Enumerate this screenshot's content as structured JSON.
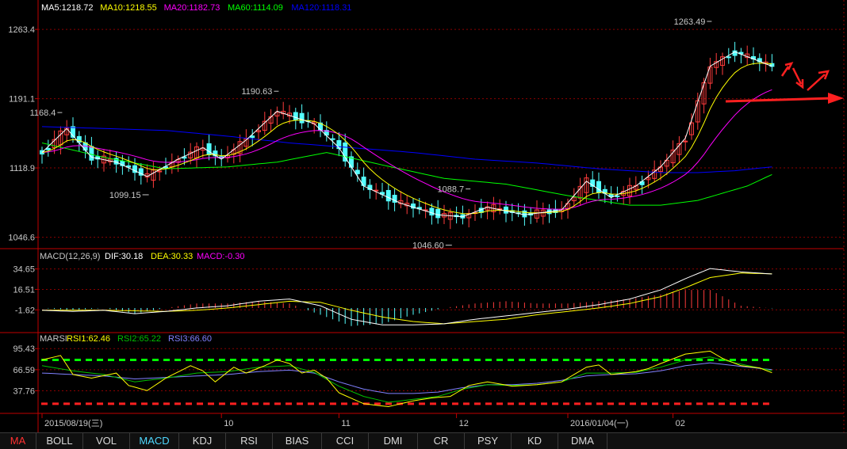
{
  "colors": {
    "up": "#ff3b3b",
    "down": "#54ffff",
    "ma5": "#ffffff",
    "ma10": "#ffff00",
    "ma20": "#ff00ff",
    "ma60": "#00ff00",
    "ma120": "#0000ff",
    "axis": "#c00000",
    "grid": "#8b0000",
    "text": "#c8c8c8",
    "annotation_arrow": "#ff2020"
  },
  "main_legend": [
    {
      "text": "MA5:1218.72",
      "color": "#ffffff"
    },
    {
      "text": "MA10:1218.55",
      "color": "#ffff00"
    },
    {
      "text": "MA20:1182.73",
      "color": "#ff00ff"
    },
    {
      "text": "MA60:1114.09",
      "color": "#00ff00"
    },
    {
      "text": "MA120:1118.31",
      "color": "#0000ff"
    }
  ],
  "macd_legend": [
    {
      "text": "MACD(12,26,9)",
      "color": "#c8c8c8"
    },
    {
      "text": "DIF:30.18",
      "color": "#ffffff"
    },
    {
      "text": "DEA:30.33",
      "color": "#ffff00"
    },
    {
      "text": "MACD:-0.30",
      "color": "#ff00ff"
    }
  ],
  "rsi_legend": [
    {
      "text": "MARSI",
      "color": "#c8c8c8"
    },
    {
      "text": "RSI1:62.46",
      "color": "#ffff00"
    },
    {
      "text": "RSI2:65.22",
      "color": "#00c000"
    },
    {
      "text": "RSI3:66.60",
      "color": "#8080ff"
    }
  ],
  "chart_data": [
    {
      "type": "candlestick",
      "panel": "price",
      "y_ticks": [
        "1263.4",
        "1191.1",
        "1118.9",
        "1046.6"
      ],
      "y_tick_values": [
        1263.4,
        1191.1,
        1118.9,
        1046.6
      ],
      "ylim": [
        1038,
        1280
      ],
      "x_tick_labels": [
        {
          "label": "2015/08/19(三)",
          "index": 0
        },
        {
          "label": "10",
          "index": 29
        },
        {
          "label": "11",
          "index": 48
        },
        {
          "label": "12",
          "index": 67
        },
        {
          "label": "2016/01/04(一)",
          "index": 85
        },
        {
          "label": "02",
          "index": 102
        }
      ],
      "annotations": [
        {
          "text": "1168.4",
          "index": 3,
          "value": 1168.4,
          "side": "high"
        },
        {
          "text": "1099.15",
          "index": 17,
          "value": 1099.15,
          "side": "low"
        },
        {
          "text": "1190.63",
          "index": 38,
          "value": 1190.63,
          "side": "high"
        },
        {
          "text": "1088.7",
          "index": 69,
          "value": 1088.7,
          "side": "high"
        },
        {
          "text": "1046.60",
          "index": 66,
          "value": 1046.6,
          "side": "low"
        },
        {
          "text": "1263.49",
          "index": 108,
          "value": 1263.49,
          "side": "high"
        }
      ],
      "series_style": {
        "ma5": "#ffffff",
        "ma10": "#ffff00",
        "ma20": "#ff00ff",
        "ma60": "#00ff00",
        "ma120": "#0000ff"
      },
      "ma60": [
        [
          0,
          1145
        ],
        [
          10,
          1130
        ],
        [
          20,
          1118
        ],
        [
          30,
          1120
        ],
        [
          38,
          1125
        ],
        [
          46,
          1135
        ],
        [
          55,
          1122
        ],
        [
          65,
          1108
        ],
        [
          75,
          1102
        ],
        [
          85,
          1090
        ],
        [
          95,
          1080
        ],
        [
          100,
          1080
        ],
        [
          106,
          1085
        ],
        [
          114,
          1100
        ],
        [
          118,
          1112
        ]
      ],
      "ma120": [
        [
          0,
          1162
        ],
        [
          10,
          1160
        ],
        [
          20,
          1158
        ],
        [
          30,
          1152
        ],
        [
          40,
          1145
        ],
        [
          50,
          1140
        ],
        [
          60,
          1135
        ],
        [
          70,
          1128
        ],
        [
          80,
          1124
        ],
        [
          90,
          1118
        ],
        [
          100,
          1114
        ],
        [
          106,
          1114
        ],
        [
          112,
          1116
        ],
        [
          118,
          1120
        ]
      ]
    },
    {
      "type": "bar+line",
      "panel": "macd",
      "title": "MACD(12,26,9)",
      "y_ticks": [
        "34.65",
        "16.51",
        "-1.62"
      ],
      "y_tick_values": [
        34.65,
        16.51,
        -1.62
      ],
      "ylim": [
        -19,
        40
      ],
      "dif": [
        [
          0,
          -2
        ],
        [
          5,
          -3
        ],
        [
          10,
          -2
        ],
        [
          15,
          -5
        ],
        [
          20,
          -3
        ],
        [
          25,
          0
        ],
        [
          30,
          2
        ],
        [
          35,
          6
        ],
        [
          40,
          8
        ],
        [
          45,
          2
        ],
        [
          50,
          -10
        ],
        [
          55,
          -15
        ],
        [
          60,
          -15
        ],
        [
          65,
          -14
        ],
        [
          70,
          -10
        ],
        [
          75,
          -7
        ],
        [
          80,
          -4
        ],
        [
          85,
          -1
        ],
        [
          90,
          3
        ],
        [
          95,
          8
        ],
        [
          100,
          16
        ],
        [
          104,
          26
        ],
        [
          108,
          35
        ],
        [
          113,
          32
        ],
        [
          118,
          30.18
        ]
      ],
      "dea": [
        [
          0,
          -2
        ],
        [
          10,
          -2
        ],
        [
          20,
          -3
        ],
        [
          25,
          -2
        ],
        [
          30,
          0
        ],
        [
          35,
          3
        ],
        [
          40,
          6
        ],
        [
          45,
          5
        ],
        [
          50,
          -2
        ],
        [
          55,
          -8
        ],
        [
          60,
          -12
        ],
        [
          65,
          -14
        ],
        [
          70,
          -12
        ],
        [
          75,
          -10
        ],
        [
          80,
          -6
        ],
        [
          85,
          -3
        ],
        [
          90,
          0
        ],
        [
          95,
          4
        ],
        [
          100,
          10
        ],
        [
          104,
          18
        ],
        [
          108,
          27
        ],
        [
          113,
          31
        ],
        [
          118,
          30.33
        ]
      ],
      "last_macd": -0.3
    },
    {
      "type": "line",
      "panel": "rsi",
      "title": "MARSI",
      "y_ticks": [
        "95.43",
        "66.59",
        "37.76"
      ],
      "y_tick_values": [
        95.43,
        66.59,
        37.76
      ],
      "ylim": [
        9,
        100
      ],
      "ref_lines": [
        {
          "value": 80,
          "color": "#00ff00"
        },
        {
          "value": 20,
          "color": "#ff2020"
        }
      ],
      "rsi1": [
        [
          0,
          80
        ],
        [
          3,
          86
        ],
        [
          5,
          60
        ],
        [
          8,
          55
        ],
        [
          12,
          62
        ],
        [
          14,
          45
        ],
        [
          17,
          38
        ],
        [
          20,
          55
        ],
        [
          24,
          72
        ],
        [
          26,
          65
        ],
        [
          28,
          50
        ],
        [
          31,
          70
        ],
        [
          33,
          62
        ],
        [
          36,
          72
        ],
        [
          38,
          80
        ],
        [
          40,
          75
        ],
        [
          42,
          62
        ],
        [
          44,
          66
        ],
        [
          46,
          55
        ],
        [
          48,
          35
        ],
        [
          52,
          20
        ],
        [
          56,
          16
        ],
        [
          60,
          24
        ],
        [
          63,
          28
        ],
        [
          66,
          30
        ],
        [
          69,
          45
        ],
        [
          72,
          50
        ],
        [
          76,
          44
        ],
        [
          80,
          46
        ],
        [
          84,
          50
        ],
        [
          88,
          70
        ],
        [
          90,
          73
        ],
        [
          92,
          60
        ],
        [
          96,
          64
        ],
        [
          98,
          68
        ],
        [
          100,
          75
        ],
        [
          104,
          88
        ],
        [
          108,
          92
        ],
        [
          110,
          82
        ],
        [
          113,
          72
        ],
        [
          116,
          69
        ],
        [
          118,
          62.46
        ]
      ],
      "rsi2": [
        [
          0,
          72
        ],
        [
          5,
          65
        ],
        [
          10,
          60
        ],
        [
          15,
          50
        ],
        [
          20,
          55
        ],
        [
          25,
          62
        ],
        [
          30,
          64
        ],
        [
          35,
          70
        ],
        [
          40,
          72
        ],
        [
          44,
          63
        ],
        [
          48,
          44
        ],
        [
          52,
          30
        ],
        [
          56,
          22
        ],
        [
          60,
          26
        ],
        [
          64,
          30
        ],
        [
          68,
          40
        ],
        [
          72,
          46
        ],
        [
          76,
          45
        ],
        [
          80,
          46
        ],
        [
          84,
          50
        ],
        [
          88,
          62
        ],
        [
          92,
          62
        ],
        [
          96,
          63
        ],
        [
          100,
          70
        ],
        [
          104,
          80
        ],
        [
          108,
          84
        ],
        [
          112,
          76
        ],
        [
          118,
          65.22
        ]
      ],
      "rsi3": [
        [
          0,
          62
        ],
        [
          5,
          60
        ],
        [
          10,
          58
        ],
        [
          15,
          54
        ],
        [
          20,
          56
        ],
        [
          25,
          58
        ],
        [
          30,
          60
        ],
        [
          35,
          64
        ],
        [
          40,
          66
        ],
        [
          44,
          62
        ],
        [
          48,
          50
        ],
        [
          52,
          40
        ],
        [
          56,
          34
        ],
        [
          60,
          34
        ],
        [
          64,
          36
        ],
        [
          68,
          42
        ],
        [
          72,
          46
        ],
        [
          76,
          46
        ],
        [
          80,
          48
        ],
        [
          84,
          52
        ],
        [
          88,
          58
        ],
        [
          92,
          60
        ],
        [
          96,
          61
        ],
        [
          100,
          65
        ],
        [
          104,
          72
        ],
        [
          108,
          76
        ],
        [
          112,
          72
        ],
        [
          118,
          66.6
        ]
      ]
    }
  ],
  "toolbar": {
    "tabs": [
      "MA",
      "BOLL",
      "VOL",
      "MACD",
      "KDJ",
      "RSI",
      "BIAS",
      "CCI",
      "DMI",
      "CR",
      "PSY",
      "KD",
      "DMA"
    ],
    "active_tab": "MA",
    "highlight_tab": "MACD"
  }
}
